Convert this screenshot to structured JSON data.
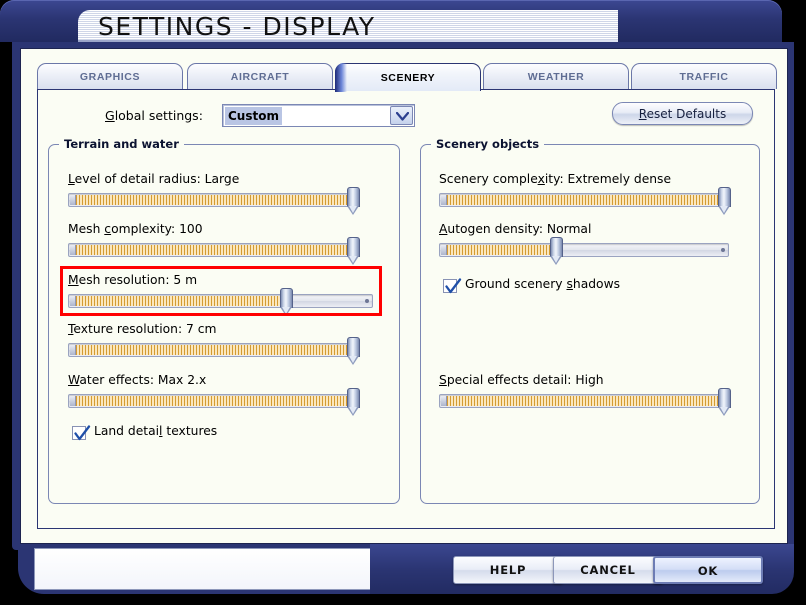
{
  "window": {
    "title": "SETTINGS - DISPLAY"
  },
  "tabs": [
    {
      "label": "GRAPHICS",
      "active": false
    },
    {
      "label": "AIRCRAFT",
      "active": false
    },
    {
      "label": "SCENERY",
      "active": true
    },
    {
      "label": "WEATHER",
      "active": false
    },
    {
      "label": "TRAFFIC",
      "active": false
    }
  ],
  "top": {
    "global_settings_label": "Global settings:",
    "global_settings_accel": "G",
    "global_settings_value": "Custom",
    "global_settings_options": [
      "Custom"
    ],
    "reset_defaults_label": "Reset Defaults",
    "reset_defaults_accel": "R",
    "dropdown_icon": "chevron-down-icon"
  },
  "terrain_group": {
    "legend": "Terrain and water",
    "sliders": [
      {
        "label": "Level of detail radius: Large",
        "setting": "Level of detail radius",
        "value": "Large",
        "accel": "L",
        "fill_percent": 100
      },
      {
        "label": "Mesh complexity: 100",
        "setting": "Mesh complexity",
        "value": "100",
        "accel": "c",
        "fill_percent": 100
      },
      {
        "label": "Mesh resolution: 5 m",
        "setting": "Mesh resolution",
        "value": "5 m",
        "accel": "M",
        "fill_percent": 72
      },
      {
        "label": "Texture resolution: 7 cm",
        "setting": "Texture resolution",
        "value": "7 cm",
        "accel": "T",
        "fill_percent": 100
      },
      {
        "label": "Water effects: Max 2.x",
        "setting": "Water effects",
        "value": "Max 2.x",
        "accel": "W",
        "fill_percent": 100
      }
    ],
    "checkbox": {
      "label": "Land detail textures",
      "accel": "l",
      "checked": true,
      "icon": "checkmark-icon"
    }
  },
  "scenery_group": {
    "legend": "Scenery objects",
    "sliders": [
      {
        "label": "Scenery complexity: Extremely dense",
        "setting": "Scenery complexity",
        "value": "Extremely dense",
        "accel": "x",
        "fill_percent": 100
      },
      {
        "label": "Autogen density: Normal",
        "setting": "Autogen density",
        "value": "Normal",
        "accel": "A",
        "fill_percent": 39
      },
      {
        "label": "Special effects detail: High",
        "setting": "Special effects detail",
        "value": "High",
        "accel": "S",
        "fill_percent": 100
      }
    ],
    "checkbox": {
      "label": "Ground scenery shadows",
      "accel": "s",
      "checked": true,
      "icon": "checkmark-icon"
    }
  },
  "highlight": {
    "color": "#ff0000",
    "targets": "Mesh resolution"
  },
  "footer": {
    "buttons": [
      {
        "label": "HELP",
        "primary": false
      },
      {
        "label": "CANCEL",
        "primary": false
      },
      {
        "label": "OK",
        "primary": true
      }
    ],
    "info_panel_text": ""
  },
  "colors": {
    "frame_navy": "#2b3573",
    "panel_bg": "#fbfdf4",
    "slider_fill": "#d39b33",
    "highlight_red": "#ff0000",
    "selection_blue": "#b9c5e4"
  }
}
